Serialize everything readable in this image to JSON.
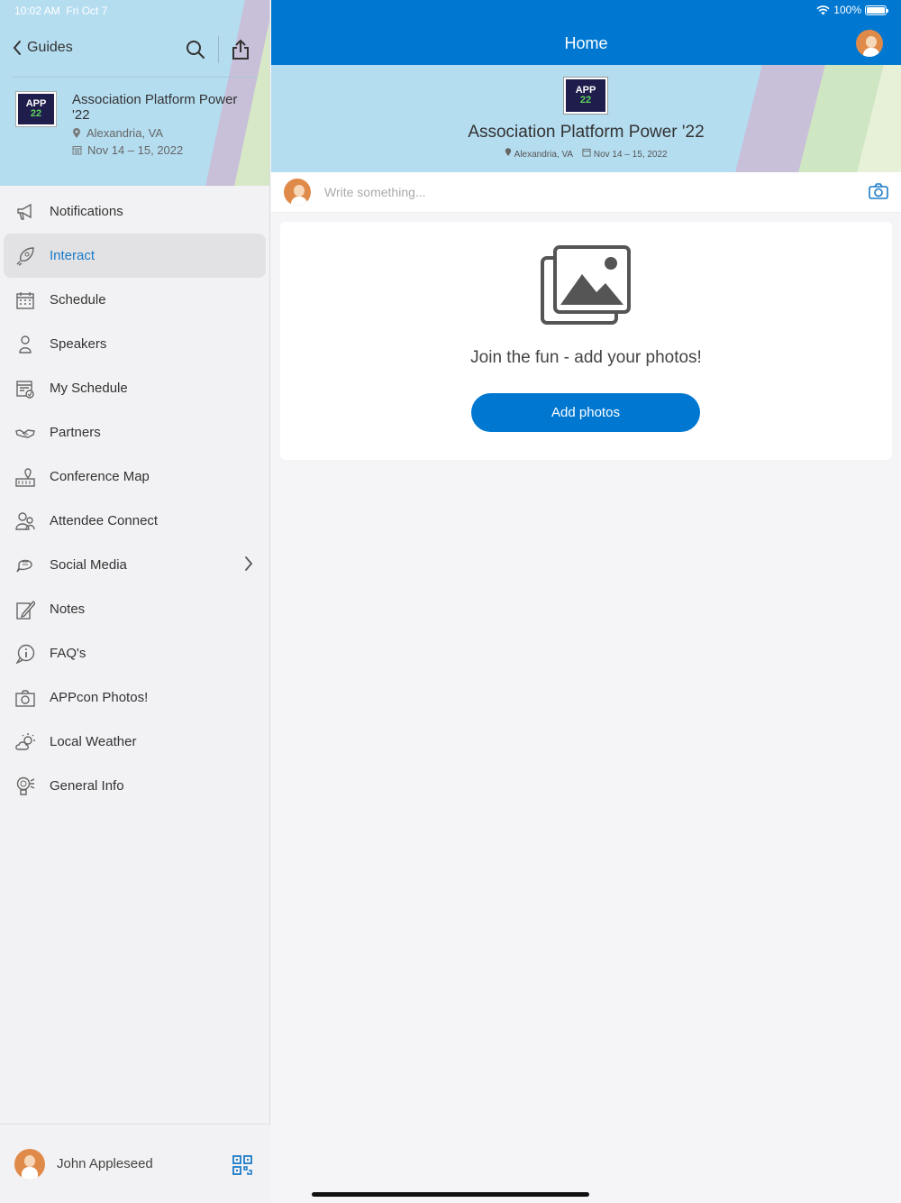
{
  "status": {
    "time": "10:02 AM",
    "date": "Fri Oct 7",
    "battery": "100%"
  },
  "sidebar": {
    "back_label": "Guides",
    "event": {
      "logo_top": "APP",
      "logo_num": "22",
      "title": "Association Platform Power '22",
      "location": "Alexandria, VA",
      "dates": "Nov 14 – 15, 2022"
    },
    "items": [
      {
        "label": "Notifications",
        "icon": "megaphone-icon"
      },
      {
        "label": "Interact",
        "icon": "rocket-icon",
        "active": true
      },
      {
        "label": "Schedule",
        "icon": "calendar-icon"
      },
      {
        "label": "Speakers",
        "icon": "speaker-person-icon"
      },
      {
        "label": "My Schedule",
        "icon": "my-schedule-icon"
      },
      {
        "label": "Partners",
        "icon": "handshake-icon"
      },
      {
        "label": "Conference Map",
        "icon": "map-pin-icon"
      },
      {
        "label": "Attendee Connect",
        "icon": "people-icon"
      },
      {
        "label": "Social Media",
        "icon": "chat-bubbles-icon",
        "has_chevron": true
      },
      {
        "label": "Notes",
        "icon": "pencil-note-icon"
      },
      {
        "label": "FAQ's",
        "icon": "info-bubble-icon"
      },
      {
        "label": "APPcon Photos!",
        "icon": "camera-icon"
      },
      {
        "label": "Local Weather",
        "icon": "sun-cloud-icon"
      },
      {
        "label": "General Info",
        "icon": "lightbulb-icon"
      }
    ],
    "user_name": "John Appleseed"
  },
  "main": {
    "title": "Home",
    "banner": {
      "logo_top": "APP",
      "logo_num": "22",
      "title": "Association Platform Power '22",
      "location": "Alexandria, VA",
      "dates": "Nov 14 – 15, 2022"
    },
    "compose_placeholder": "Write something...",
    "empty_message": "Join the fun - add your photos!",
    "add_button": "Add photos"
  },
  "colors": {
    "accent": "#0078d1",
    "banner": "#b5ddf0",
    "active_text": "#1a7bc7"
  }
}
